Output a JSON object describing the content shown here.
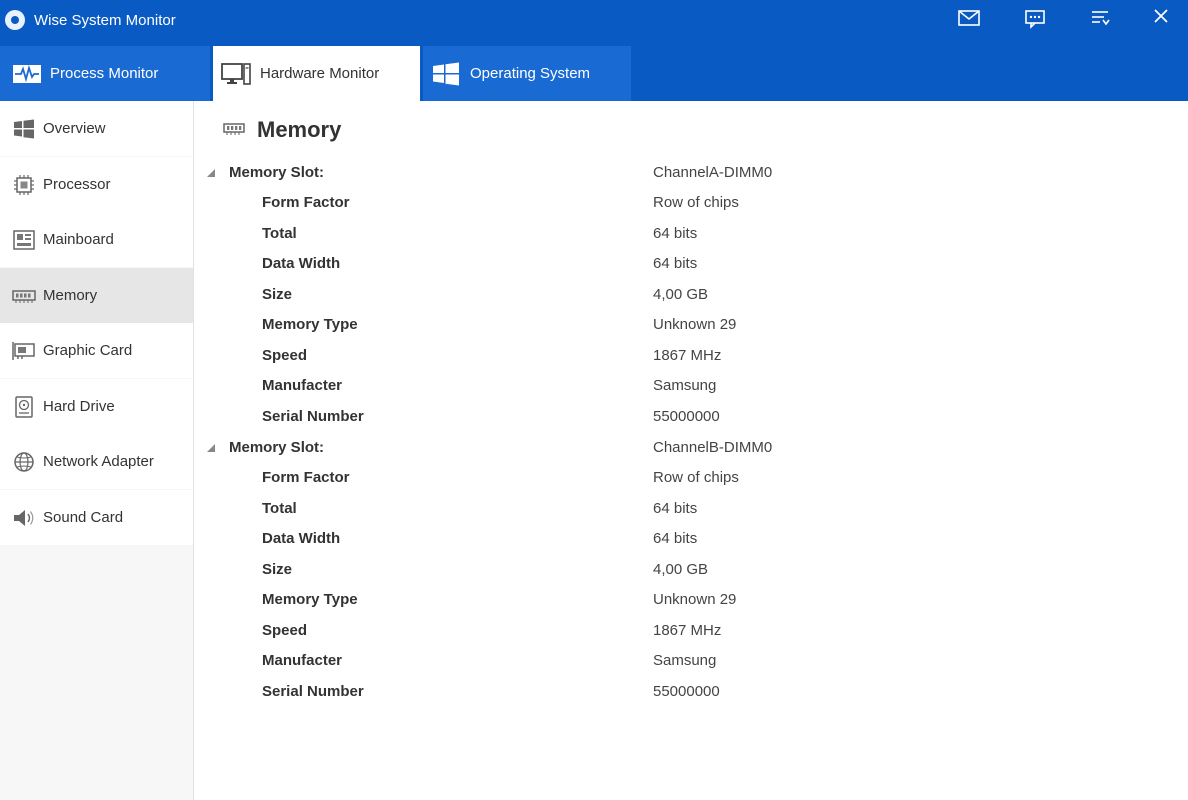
{
  "app": {
    "title": "Wise System Monitor"
  },
  "window_controls": [
    {
      "name": "mail-icon"
    },
    {
      "name": "feedback-icon"
    },
    {
      "name": "menu-icon"
    },
    {
      "name": "close-icon"
    }
  ],
  "tabs": [
    {
      "label": "Process Monitor",
      "icon": "pulse-icon"
    },
    {
      "label": "Hardware Monitor",
      "icon": "computer-icon",
      "active": true
    },
    {
      "label": "Operating System",
      "icon": "windows-icon"
    }
  ],
  "sidebar": {
    "items": [
      {
        "label": "Overview",
        "icon": "windows-icon"
      },
      {
        "label": "Processor",
        "icon": "cpu-icon"
      },
      {
        "label": "Mainboard",
        "icon": "mainboard-icon"
      },
      {
        "label": "Memory",
        "icon": "memory-icon",
        "active": true
      },
      {
        "label": "Graphic Card",
        "icon": "graphic-card-icon"
      },
      {
        "label": "Hard Drive",
        "icon": "hard-drive-icon"
      },
      {
        "label": "Network Adapter",
        "icon": "network-icon"
      },
      {
        "label": "Sound Card",
        "icon": "speaker-icon"
      }
    ]
  },
  "main": {
    "title": "Memory",
    "slots": [
      {
        "label": "Memory Slot:",
        "value": "ChannelA-DIMM0",
        "properties": [
          {
            "label": "Form Factor",
            "value": "Row of chips"
          },
          {
            "label": "Total",
            "value": "64 bits"
          },
          {
            "label": "Data Width",
            "value": "64 bits"
          },
          {
            "label": "Size",
            "value": "4,00 GB"
          },
          {
            "label": "Memory Type",
            "value": "Unknown 29"
          },
          {
            "label": "Speed",
            "value": "1867 MHz"
          },
          {
            "label": "Manufacter",
            "value": "Samsung"
          },
          {
            "label": "Serial Number",
            "value": "55000000"
          }
        ]
      },
      {
        "label": "Memory Slot:",
        "value": "ChannelB-DIMM0",
        "properties": [
          {
            "label": "Form Factor",
            "value": "Row of chips"
          },
          {
            "label": "Total",
            "value": "64 bits"
          },
          {
            "label": "Data Width",
            "value": "64 bits"
          },
          {
            "label": "Size",
            "value": "4,00 GB"
          },
          {
            "label": "Memory Type",
            "value": "Unknown 29"
          },
          {
            "label": "Speed",
            "value": "1867 MHz"
          },
          {
            "label": "Manufacter",
            "value": "Samsung"
          },
          {
            "label": "Serial Number",
            "value": "55000000"
          }
        ]
      }
    ]
  },
  "colors": {
    "accent": "#0a5ac4",
    "tab_inactive": "#1a6ad4",
    "sidebar_active": "#e6e6e6"
  }
}
